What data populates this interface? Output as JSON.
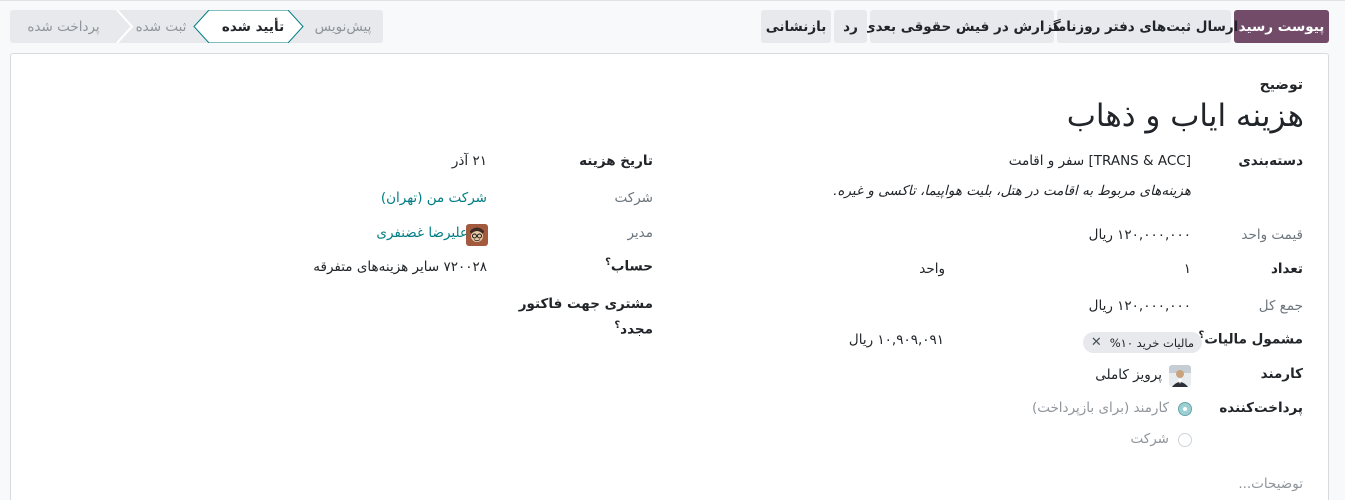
{
  "actions": {
    "attach_receipt": "پیوست رسید",
    "post_journal": "ارسال ثبت‌های دفتر روزنامه",
    "report_payslip": "گزارش در فیش حقوقی بعدی",
    "refuse": "رد",
    "reset": "بازنشانی"
  },
  "statusbar": {
    "stages": [
      "پیش‌نویس",
      "تأیید شده",
      "ثبت شده",
      "پرداخت شده"
    ],
    "active": "تأیید شده"
  },
  "form": {
    "description_label": "توضیح",
    "title": "هزینه ایاب و ذهاب",
    "category_label": "دسته‌بندی",
    "category_value": "[TRANS & ACC] سفر و اقامت",
    "category_note": "هزینه‌های مربوط به اقامت در هتل، بلیت هواپیما، تاکسی و غیره.",
    "unit_price_label": "قیمت واحد",
    "unit_price_value": "۱۲۰,۰۰۰,۰۰۰ ریال",
    "quantity_label": "تعداد",
    "quantity_value": "۱",
    "quantity_uom": "واحد",
    "total_label": "جمع کل",
    "total_value": "۱۲۰,۰۰۰,۰۰۰ ریال",
    "tax_label": "مشمول مالیات",
    "tax_tag": "مالیات خرید ۱۰%",
    "tax_amount": "۱۰,۹۰۹,۰۹۱ ریال",
    "employee_label": "کارمند",
    "employee_value": "پرویز کاملی",
    "paid_by_label": "پرداخت‌کننده",
    "paid_by_options": [
      "کارمند (برای بازپرداخت)",
      "شرکت"
    ],
    "paid_by_selected": "کارمند (برای بازپرداخت)",
    "date_label": "تاریخ هزینه",
    "date_value": "۲۱ آذر",
    "company_label": "شرکت",
    "company_value": "شرکت من (تهران)",
    "manager_label": "مدیر",
    "manager_value": "علیرضا غضنفری",
    "account_label": "حساب",
    "account_value": "۷۲۰۰۲۸ سایر هزینه‌های متفرقه",
    "reinvoice_label_line1": "مشتری جهت فاکتور",
    "reinvoice_label_line2": "مجدد",
    "notes_placeholder": "توضیحات..."
  },
  "colors": {
    "primary": "#714b67",
    "link": "#017e84",
    "radio_checked": "#9ed0d3"
  },
  "icons": {
    "help": "help-tooltip-icon",
    "tag_remove": "close-icon",
    "employee_avatar": "avatar-image",
    "manager_avatar": "avatar-image"
  }
}
